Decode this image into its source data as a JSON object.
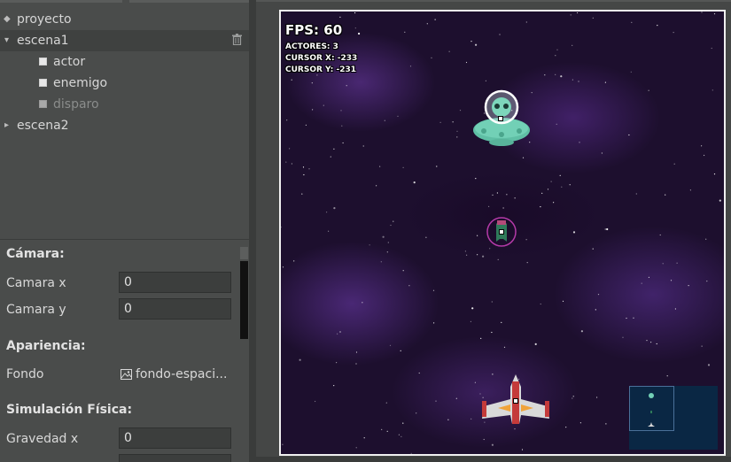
{
  "tree": {
    "items": [
      {
        "label": "proyecto",
        "glyph": "◆",
        "kind": "project"
      },
      {
        "label": "escena1",
        "glyph": "▾",
        "kind": "scene",
        "selected": true
      },
      {
        "label": "actor",
        "kind": "actor"
      },
      {
        "label": "enemigo",
        "kind": "actor"
      },
      {
        "label": "disparo",
        "kind": "actor",
        "dimmed": true
      },
      {
        "label": "escena2",
        "glyph": "▸",
        "kind": "scene"
      }
    ]
  },
  "props": {
    "camera_section": "Cámara:",
    "camera_x_label": "Camara x",
    "camera_x_value": "0",
    "camera_y_label": "Camara y",
    "camera_y_value": "0",
    "appearance_section": "Apariencia:",
    "background_label": "Fondo",
    "background_value": "fondo-espaci...",
    "physics_section": "Simulación Física:",
    "gravity_x_label": "Gravedad x",
    "gravity_x_value": "0"
  },
  "game": {
    "fps": "FPS: 60",
    "actors": "ACTORES: 3",
    "cursor_x": "CURSOR X: -233",
    "cursor_y": "CURSOR Y: -231",
    "actors_on_stage": [
      "alien-ufo",
      "enemy-ship",
      "player-ship"
    ]
  },
  "colors": {
    "panel": "#4a4c4b",
    "selected_row": "#3f4140",
    "space_bg": "#1d0f2e",
    "minimap": "#0a2744"
  }
}
